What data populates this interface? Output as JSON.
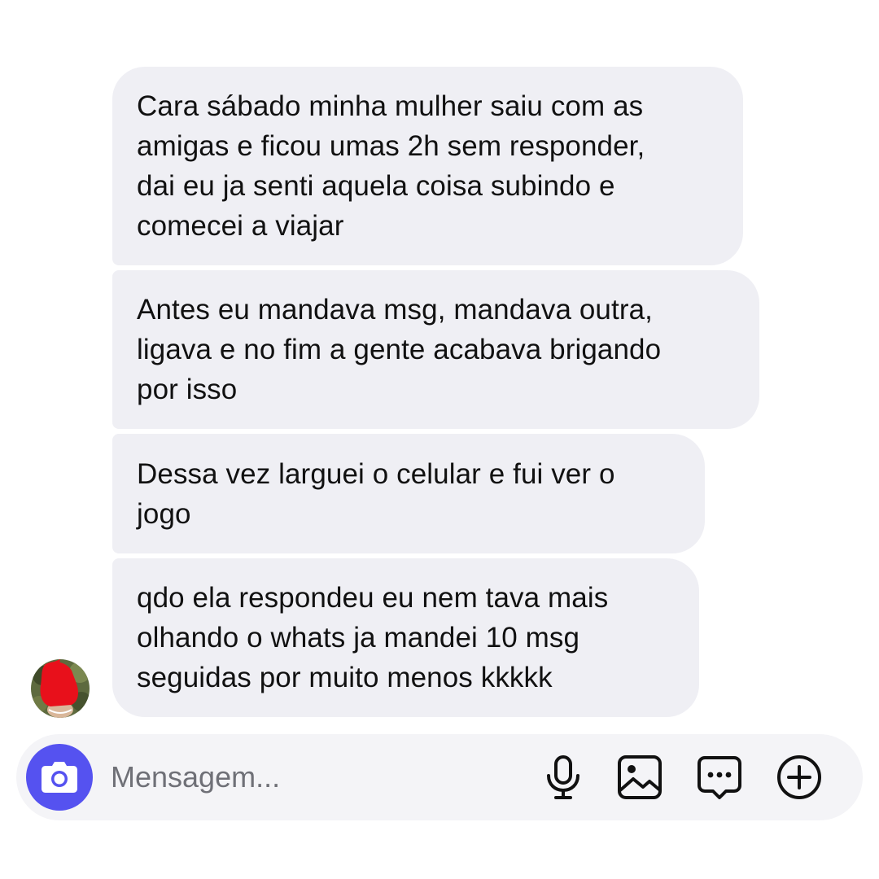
{
  "messages": [
    {
      "text": "Cara sábado minha mulher saiu com as\namigas e ficou umas 2h sem responder,\ndai eu ja senti aquela coisa subindo e\ncomecei a viajar"
    },
    {
      "text": "Antes eu mandava msg, mandava outra,\nligava e no fim a gente acabava brigando\npor isso"
    },
    {
      "text": "Dessa vez larguei o celular e fui ver o\njogo"
    },
    {
      "text": "qdo ela respondeu eu nem tava mais\nolhando o whats ja mandei 10 msg\nseguidas por muito menos kkkkk"
    }
  ],
  "composer": {
    "placeholder": "Mensagem...",
    "camera_icon": "camera-icon",
    "tools": [
      "microphone-icon",
      "image-icon",
      "sticker-message-icon",
      "plus-circle-icon"
    ]
  },
  "colors": {
    "bubble": "#efeff4",
    "camera_button": "#5552f0",
    "composer_bg": "#f4f4f7",
    "placeholder": "#6f7077"
  }
}
